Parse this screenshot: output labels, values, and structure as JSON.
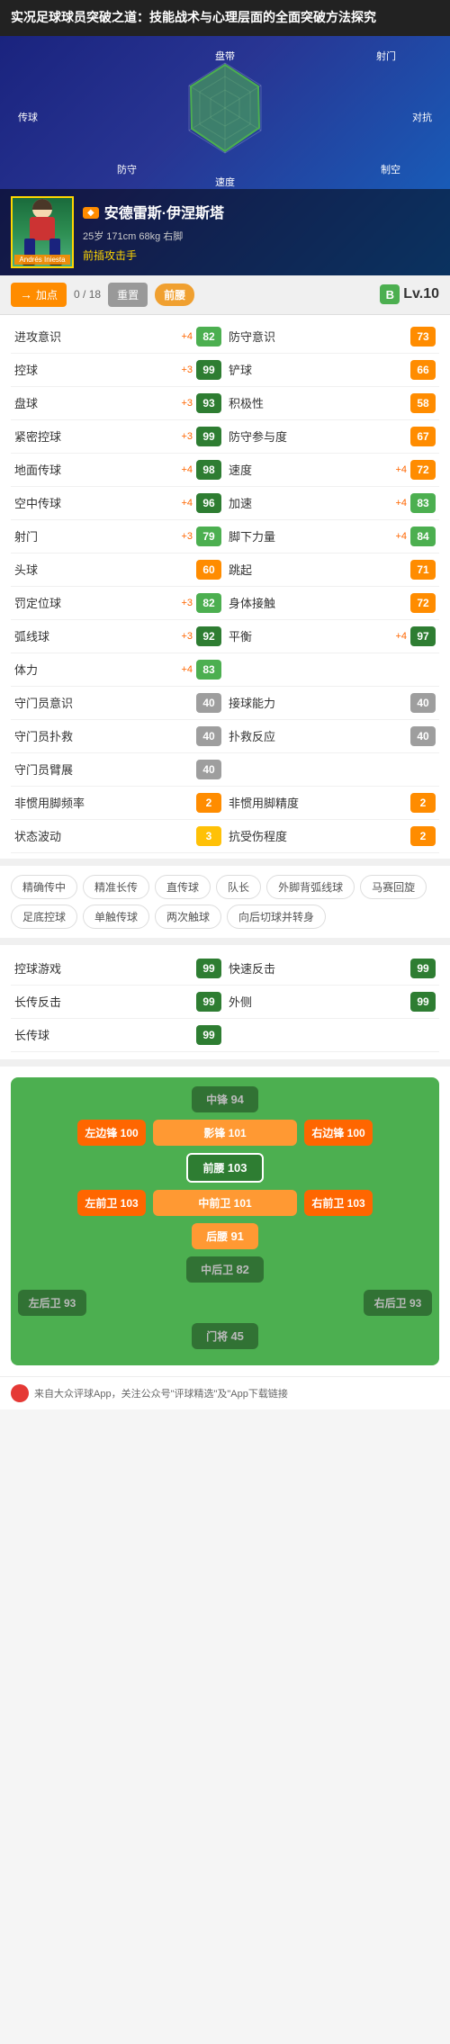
{
  "title": "实况足球球员突破之道：技能战术与心理层面的全面突破方法探究",
  "player": {
    "name": "安德雷斯·伊涅斯塔",
    "meta": "25岁 171cm 68kg 右脚",
    "position": "前插攻击手",
    "photo_name": "Andrés Iniesta"
  },
  "toolbar": {
    "add_points_label": "加点",
    "points_used": "0",
    "points_total": "18",
    "reset_label": "重置",
    "position_label": "前腰",
    "level_letter": "B",
    "level_prefix": "Lv.",
    "level_num": "10"
  },
  "radar": {
    "labels": [
      "盘带",
      "射门",
      "对抗",
      "制空",
      "防守",
      "速度",
      "传球"
    ]
  },
  "stats": [
    {
      "name": "进攻意识",
      "plus": "+4",
      "value": "82",
      "color": "green",
      "col": 0
    },
    {
      "name": "防守意识",
      "plus": "",
      "value": "73",
      "color": "orange",
      "col": 1
    },
    {
      "name": "控球",
      "plus": "+3",
      "value": "99",
      "color": "dark-green",
      "col": 0
    },
    {
      "name": "铲球",
      "plus": "",
      "value": "66",
      "color": "orange",
      "col": 1
    },
    {
      "name": "盘球",
      "plus": "+3",
      "value": "93",
      "color": "dark-green",
      "col": 0
    },
    {
      "name": "积极性",
      "plus": "",
      "value": "58",
      "color": "orange",
      "col": 1
    },
    {
      "name": "紧密控球",
      "plus": "+3",
      "value": "99",
      "color": "dark-green",
      "col": 0
    },
    {
      "name": "防守参与度",
      "plus": "",
      "value": "67",
      "color": "orange",
      "col": 1
    },
    {
      "name": "地面传球",
      "plus": "+4",
      "value": "98",
      "color": "dark-green",
      "col": 0
    },
    {
      "name": "速度",
      "plus": "+4",
      "value": "72",
      "color": "orange",
      "col": 1
    },
    {
      "name": "空中传球",
      "plus": "+4",
      "value": "96",
      "color": "dark-green",
      "col": 0
    },
    {
      "name": "加速",
      "plus": "+4",
      "value": "83",
      "color": "green",
      "col": 1
    },
    {
      "name": "射门",
      "plus": "+3",
      "value": "79",
      "color": "green",
      "col": 0
    },
    {
      "name": "脚下力量",
      "plus": "+4",
      "value": "84",
      "color": "green",
      "col": 1
    },
    {
      "name": "头球",
      "plus": "",
      "value": "60",
      "color": "orange",
      "col": 0
    },
    {
      "name": "跳起",
      "plus": "",
      "value": "71",
      "color": "orange",
      "col": 1
    },
    {
      "name": "罚定位球",
      "plus": "+3",
      "value": "82",
      "color": "green",
      "col": 0
    },
    {
      "name": "身体接触",
      "plus": "",
      "value": "72",
      "color": "orange",
      "col": 1
    },
    {
      "name": "弧线球",
      "plus": "+3",
      "value": "92",
      "color": "dark-green",
      "col": 0
    },
    {
      "name": "平衡",
      "plus": "+4",
      "value": "97",
      "color": "dark-green",
      "col": 1
    },
    {
      "name": "体力",
      "plus": "+4",
      "value": "83",
      "color": "green",
      "col": 0
    },
    {
      "name": "",
      "plus": "",
      "value": "",
      "color": "",
      "col": 1
    },
    {
      "name": "守门员意识",
      "plus": "",
      "value": "40",
      "color": "gray",
      "col": 0
    },
    {
      "name": "接球能力",
      "plus": "",
      "value": "40",
      "color": "gray",
      "col": 1
    },
    {
      "name": "守门员扑救",
      "plus": "",
      "value": "40",
      "color": "gray",
      "col": 0
    },
    {
      "name": "扑救反应",
      "plus": "",
      "value": "40",
      "color": "gray",
      "col": 1
    },
    {
      "name": "守门员臂展",
      "plus": "",
      "value": "40",
      "color": "gray",
      "col": 0
    },
    {
      "name": "",
      "plus": "",
      "value": "",
      "color": "",
      "col": 1
    },
    {
      "name": "非惯用脚频率",
      "plus": "",
      "value": "2",
      "color": "orange",
      "col": 0
    },
    {
      "name": "非惯用脚精度",
      "plus": "",
      "value": "2",
      "color": "orange",
      "col": 1
    },
    {
      "name": "状态波动",
      "plus": "",
      "value": "3",
      "color": "yellow",
      "col": 0
    },
    {
      "name": "抗受伤程度",
      "plus": "",
      "value": "2",
      "color": "orange",
      "col": 1
    }
  ],
  "skills": [
    "精确传中",
    "精准长传",
    "直传球",
    "队长",
    "外脚背弧线球",
    "马赛回旋",
    "足底控球",
    "单触传球",
    "两次触球",
    "向后切球并转身"
  ],
  "style_stats": [
    {
      "name": "控球游戏",
      "value": "99",
      "color": "dark-green"
    },
    {
      "name": "快速反击",
      "value": "99",
      "color": "dark-green"
    },
    {
      "name": "长传反击",
      "value": "99",
      "color": "dark-green"
    },
    {
      "name": "外侧",
      "value": "99",
      "color": "dark-green"
    },
    {
      "name": "长传球",
      "value": "99",
      "color": "dark-green"
    }
  ],
  "positions": {
    "rows": [
      {
        "type": "center",
        "items": [
          {
            "label": "中锋",
            "value": "94",
            "style": "inactive"
          }
        ]
      },
      {
        "type": "sides+center",
        "left": {
          "label": "左边锋",
          "value": "100",
          "style": "active"
        },
        "center": {
          "label": "影锋",
          "value": "101",
          "style": "semi"
        },
        "right": {
          "label": "右边锋",
          "value": "100",
          "style": "active"
        }
      },
      {
        "type": "center",
        "items": [
          {
            "label": "前腰",
            "value": "103",
            "style": "highlight"
          }
        ]
      },
      {
        "type": "sides+center",
        "left": {
          "label": "左前卫",
          "value": "103",
          "style": "active"
        },
        "center": {
          "label": "中前卫",
          "value": "101",
          "style": "semi"
        },
        "right": {
          "label": "右前卫",
          "value": "103",
          "style": "active"
        }
      },
      {
        "type": "center",
        "items": [
          {
            "label": "后腰",
            "value": "91",
            "style": "semi"
          }
        ]
      },
      {
        "type": "center",
        "items": [
          {
            "label": "中后卫",
            "value": "82",
            "style": "inactive"
          }
        ]
      },
      {
        "type": "sides",
        "left": {
          "label": "左后卫",
          "value": "93",
          "style": "inactive"
        },
        "right": {
          "label": "右后卫",
          "value": "93",
          "style": "inactive"
        }
      },
      {
        "type": "center",
        "items": [
          {
            "label": "门将",
            "value": "45",
            "style": "inactive"
          }
        ]
      }
    ]
  },
  "footer": {
    "text": "来自大众评球App，关注公众号\"评球精选\"及\"App下载链接"
  }
}
